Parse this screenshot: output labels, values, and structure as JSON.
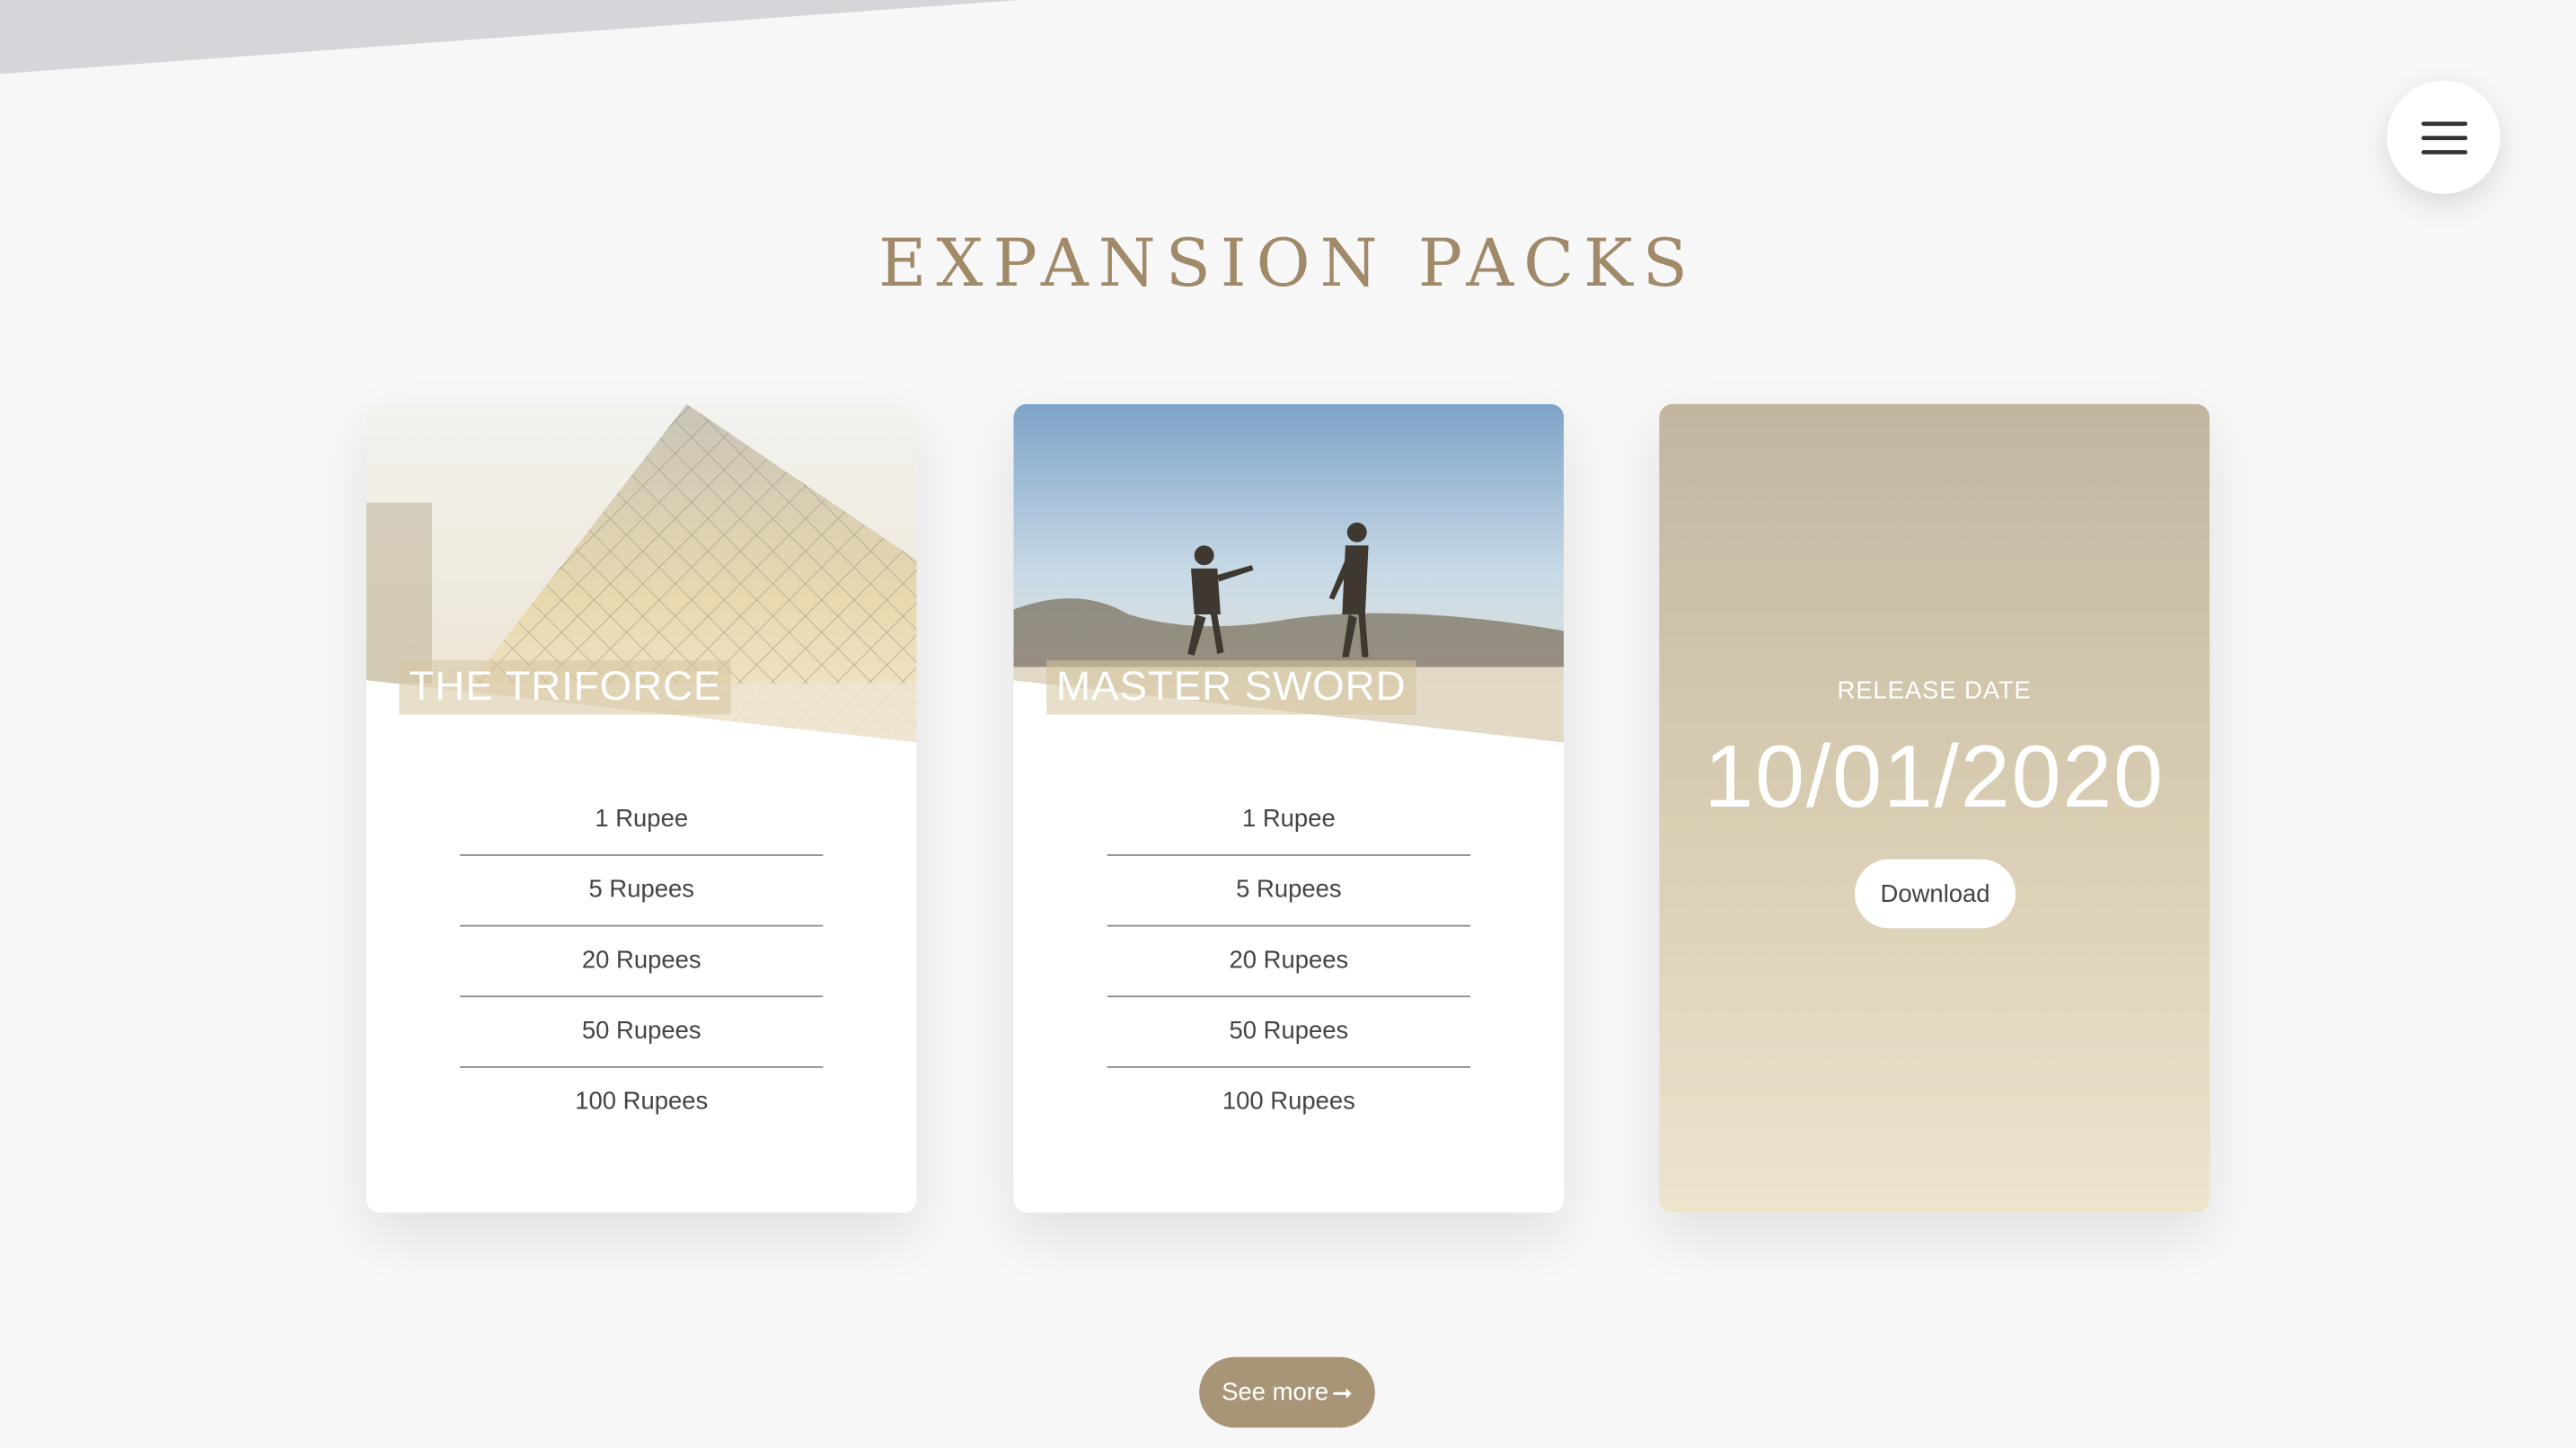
{
  "page": {
    "section_title": "EXPANSION PACKS",
    "menu_icon": "hamburger-menu-icon"
  },
  "cards": [
    {
      "title": "THE TRIFORCE",
      "image": "glass-pyramid-photo",
      "prices": [
        "1 Rupee",
        "5 Rupees",
        "20 Rupees",
        "50 Rupees",
        "100 Rupees"
      ]
    },
    {
      "title": "MASTER SWORD",
      "image": "two-people-hillside-photo",
      "prices": [
        "1 Rupee",
        "5 Rupees",
        "20 Rupees",
        "50 Rupees",
        "100 Rupees"
      ]
    }
  ],
  "release": {
    "label": "RELEASE DATE",
    "date": "10/01/2020",
    "download_label": "Download"
  },
  "footer": {
    "see_more_label": "See more",
    "see_more_arrow": "➞"
  },
  "colors": {
    "background": "#f7f7f7",
    "accent_gold": "#a08a6a",
    "button_tan": "#a89577",
    "release_card_top": "#c2b69f",
    "release_card_bottom": "#ede4cc"
  }
}
